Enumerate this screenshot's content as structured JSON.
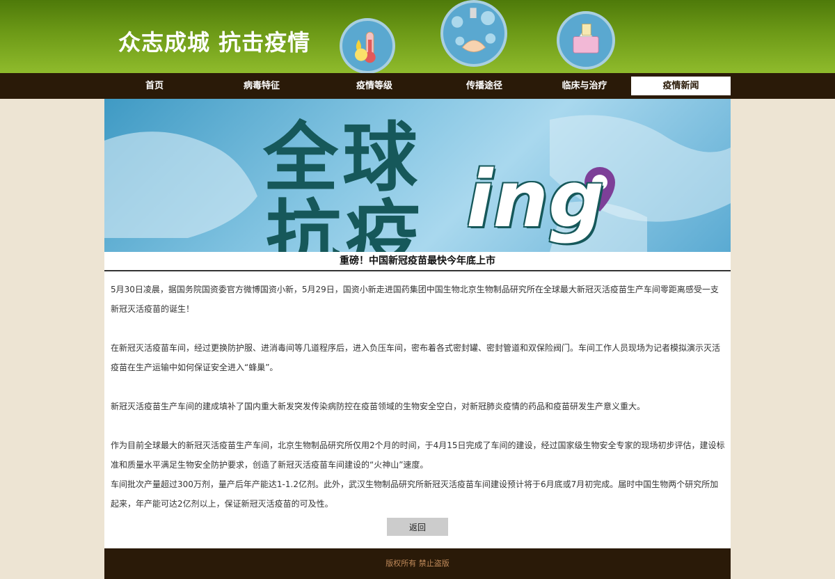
{
  "header": {
    "slogan": "众志成城 抗击疫情",
    "icons": [
      "thermometer-icon",
      "handwash-icon",
      "tissue-icon"
    ]
  },
  "nav": {
    "items": [
      {
        "label": "首页"
      },
      {
        "label": "病毒特征"
      },
      {
        "label": "疫情等级"
      },
      {
        "label": "传播途径"
      },
      {
        "label": "临床与治疗"
      },
      {
        "label": "疫情新闻",
        "active": true
      }
    ]
  },
  "banner": {
    "line1": "全球",
    "line2": "抗疫",
    "line3": "ing"
  },
  "article": {
    "title": "重磅！中国新冠疫苗最快今年底上市",
    "paragraphs": [
      "5月30日凌晨，据国务院国资委官方微博国资小新，5月29日，国资小新走进国药集团中国生物北京生物制品研究所在全球最大新冠灭活疫苗生产车间零距离感受一支新冠灭活疫苗的诞生！",
      "在新冠灭活疫苗车间，经过更换防护服、进消毒间等几道程序后，进入负压车间，密布着各式密封罐、密封管道和双保险阀门。车间工作人员现场为记者模拟演示灭活疫苗在生产运输中如何保证安全进入“蜂巢”。",
      "新冠灭活疫苗生产车间的建成填补了国内重大新发突发传染病防控在疫苗领域的生物安全空白，对新冠肺炎疫情的药品和疫苗研发生产意义重大。",
      "作为目前全球最大的新冠灭活疫苗生产车间，北京生物制品研究所仅用2个月的时间，于4月15日完成了车间的建设，经过国家级生物安全专家的现场初步评估，建设标准和质量水平满足生物安全防护要求，创造了新冠灭活疫苗车间建设的“火神山”速度。",
      "车间批次产量超过300万剂，量产后年产能达1-1.2亿剂。此外，武汉生物制品研究所新冠灭活疫苗车间建设预计将于6月底或7月初完成。届时中国生物两个研究所加起来，年产能可达2亿剂以上，保证新冠灭活疫苗的可及性。"
    ],
    "back_label": "返回"
  },
  "footer": {
    "text": "版权所有 禁止盗版"
  },
  "colors": {
    "header_green": "#6d9a17",
    "nav_brown": "#2a1a08",
    "page_bg": "#ede4d3",
    "footer_text": "#c08a5a"
  }
}
